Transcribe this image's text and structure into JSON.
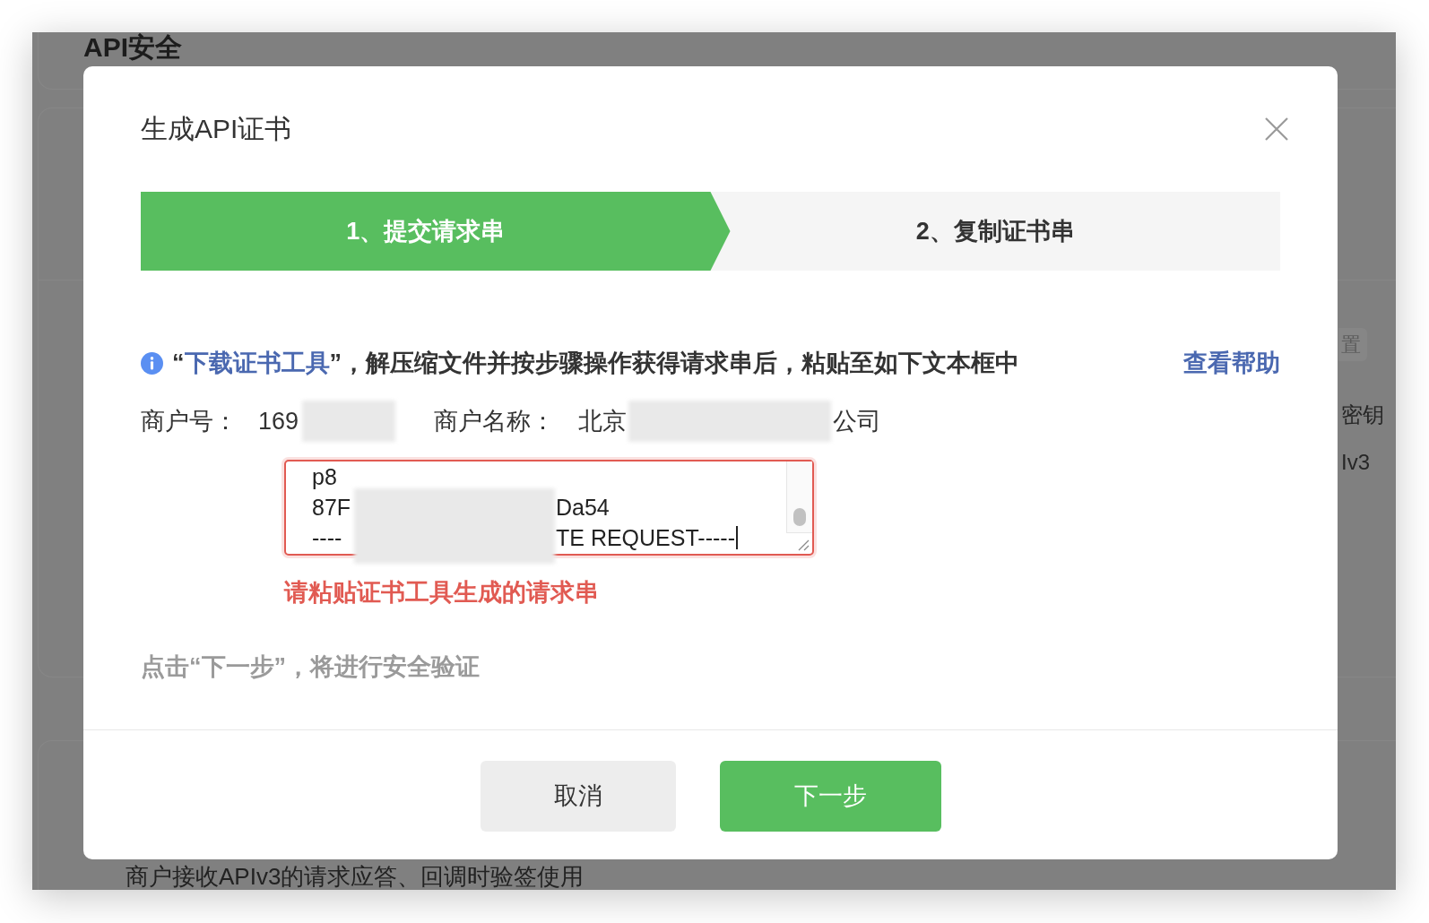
{
  "background_page": {
    "heading": "API安全",
    "side_button": "置",
    "side_texts": [
      "密钥",
      "Iv3"
    ],
    "bottom_text": "商户接收APIv3的请求应答、回调时验签使用"
  },
  "dialog": {
    "title": "生成API证书",
    "steps": [
      {
        "label": "1、提交请求串",
        "selected": true
      },
      {
        "label": "2、复制证书串",
        "selected": false
      }
    ],
    "instruction": {
      "before": "“",
      "link": "下载证书工具",
      "after": "”，解压缩文件并按步骤操作获得请求串后，粘贴至如下文本框中"
    },
    "help_link": "查看帮助",
    "merchant_no": {
      "label": "商户号：",
      "value": "169"
    },
    "merchant_name": {
      "label": "商户名称：",
      "value_start": "北京",
      "value_end": "公司"
    },
    "request_field": {
      "value_lines": [
        [
          "p8"
        ],
        [
          "87F",
          "Da54"
        ],
        [
          "----",
          "TE REQUEST-----"
        ]
      ],
      "invalid": true
    },
    "error_message": "请粘贴证书工具生成的请求串",
    "note": "点击“下一步”，将进行安全验证",
    "buttons": [
      {
        "label": "取消",
        "kind": "secondary"
      },
      {
        "label": "下一步",
        "kind": "primary"
      }
    ]
  }
}
